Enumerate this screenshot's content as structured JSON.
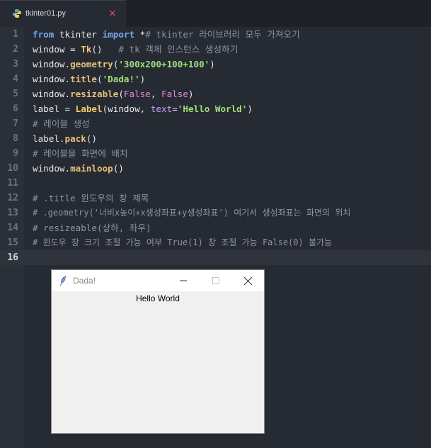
{
  "tab": {
    "filename": "tkinter01.py",
    "close_symbol": "×"
  },
  "gutter": {
    "line_numbers": [
      "1",
      "2",
      "3",
      "4",
      "5",
      "6",
      "7",
      "8",
      "9",
      "10",
      "11",
      "12",
      "13",
      "14",
      "15",
      "16"
    ]
  },
  "code": {
    "l1": {
      "from": "from",
      "mod": " tkinter ",
      "import": "import",
      "rest": " *",
      "comment": "# tkinter 라이브러리 모두 가져오기"
    },
    "l2": {
      "a": "window = ",
      "b": "Tk",
      "c": "()",
      "comment": "   # tk 객체 인스턴스 생성하기"
    },
    "l3": {
      "a": "window.",
      "b": "geometry",
      "c": "(",
      "d": "'300x200+100+100'",
      "e": ")"
    },
    "l4": {
      "a": "window.",
      "b": "title",
      "c": "(",
      "d": "'Dada!'",
      "e": ")"
    },
    "l5": {
      "a": "window.",
      "b": "resizable",
      "c": "(",
      "d": "False",
      "e": ", ",
      "f": "False",
      "g": ")"
    },
    "l6": {
      "a": "label = ",
      "b": "Label",
      "c": "(window, ",
      "d": "text",
      "e": "=",
      "f": "'Hello World'",
      "g": ")"
    },
    "l7": {
      "comment": "# 레이블 생성"
    },
    "l8": {
      "a": "label.",
      "b": "pack",
      "c": "()"
    },
    "l9": {
      "comment": "# 레이블을 화면에 배치"
    },
    "l10": {
      "a": "window.",
      "b": "mainloop",
      "c": "()"
    },
    "l12": {
      "comment": "# .title 윈도우의 창 제목"
    },
    "l13": {
      "comment": "# .geometry('너비x높이+x생성좌표+y생성좌표') 여기서 생성좌표는 화면의 위치"
    },
    "l14": {
      "comment": "# resizeable(상하, 좌우)"
    },
    "l15": {
      "comment": "# 윈도우 창 크기 조절 가능 여부 True(1) 창 조절 가능 False(0) 불가능"
    }
  },
  "tk_window": {
    "title": "Dada!",
    "label": "Hello World"
  },
  "colors": {
    "editor_bg": "#262a32",
    "keyword": "#7aa6f0",
    "string": "#9fe07a",
    "boolean": "#e08ae0",
    "comment": "#8d94a0",
    "close": "#e0505a"
  }
}
